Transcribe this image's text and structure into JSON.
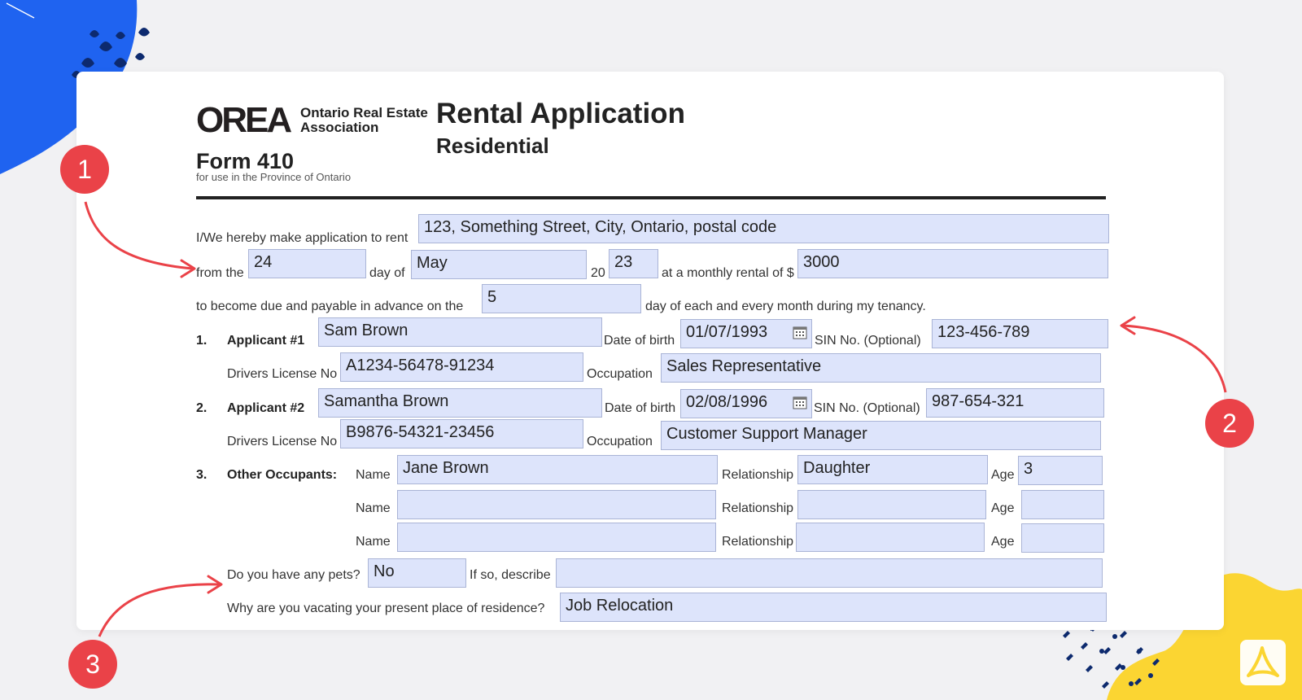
{
  "header": {
    "logo_text": "OREA",
    "org_line1": "Ontario Real Estate",
    "org_line2": "Association",
    "form_number": "Form 410",
    "form_scope": "for use in the Province of Ontario",
    "title": "Rental Application",
    "subtitle": "Residential"
  },
  "form": {
    "intro_label": "I/We hereby make application to rent",
    "property_address": "123, Something Street, City, Ontario, postal code",
    "from_the_label": "from the",
    "day": "24",
    "day_of_label": "day of",
    "month": "May",
    "year_prefix": "20",
    "year": "23",
    "monthly_rental_label": "at a monthly rental of $",
    "monthly_rent": "3000",
    "due_label": "to become due and payable in advance on the",
    "due_day": "5",
    "due_suffix": "day of each and every month during my tenancy.",
    "labels": {
      "date_of_birth": "Date of birth",
      "sin": "SIN No. (Optional)",
      "drivers_license": "Drivers License No",
      "occupation": "Occupation",
      "name": "Name",
      "relationship": "Relationship",
      "age": "Age"
    },
    "applicant1": {
      "number": "1.",
      "label": "Applicant #1",
      "name": "Sam Brown",
      "dob": "01/07/1993",
      "sin": "123-456-789",
      "license": "A1234-56478-91234",
      "occupation": "Sales Representative"
    },
    "applicant2": {
      "number": "2.",
      "label": "Applicant #2",
      "name": "Samantha Brown",
      "dob": "02/08/1996",
      "sin": "987-654-321",
      "license": "B9876-54321-23456",
      "occupation": "Customer Support Manager"
    },
    "occupants": {
      "number": "3.",
      "label": "Other Occupants:",
      "rows": [
        {
          "name": "Jane Brown",
          "relationship": "Daughter",
          "age": "3"
        },
        {
          "name": "",
          "relationship": "",
          "age": ""
        },
        {
          "name": "",
          "relationship": "",
          "age": ""
        }
      ]
    },
    "pets_label": "Do you have any pets?",
    "pets": "No",
    "describe_label": "If so, describe",
    "pets_description": "",
    "vacating_label": "Why are you vacating your present place of residence?",
    "vacating_reason": "Job Relocation"
  },
  "callouts": [
    "1",
    "2",
    "3"
  ],
  "colors": {
    "field_bg": "#dde4fb",
    "callout": "#ea4248",
    "accent_blue": "#1f63f0",
    "accent_yellow": "#fbd532"
  },
  "icons": [
    "calendar-icon",
    "pdf-logo-icon",
    "arrow-icon"
  ]
}
